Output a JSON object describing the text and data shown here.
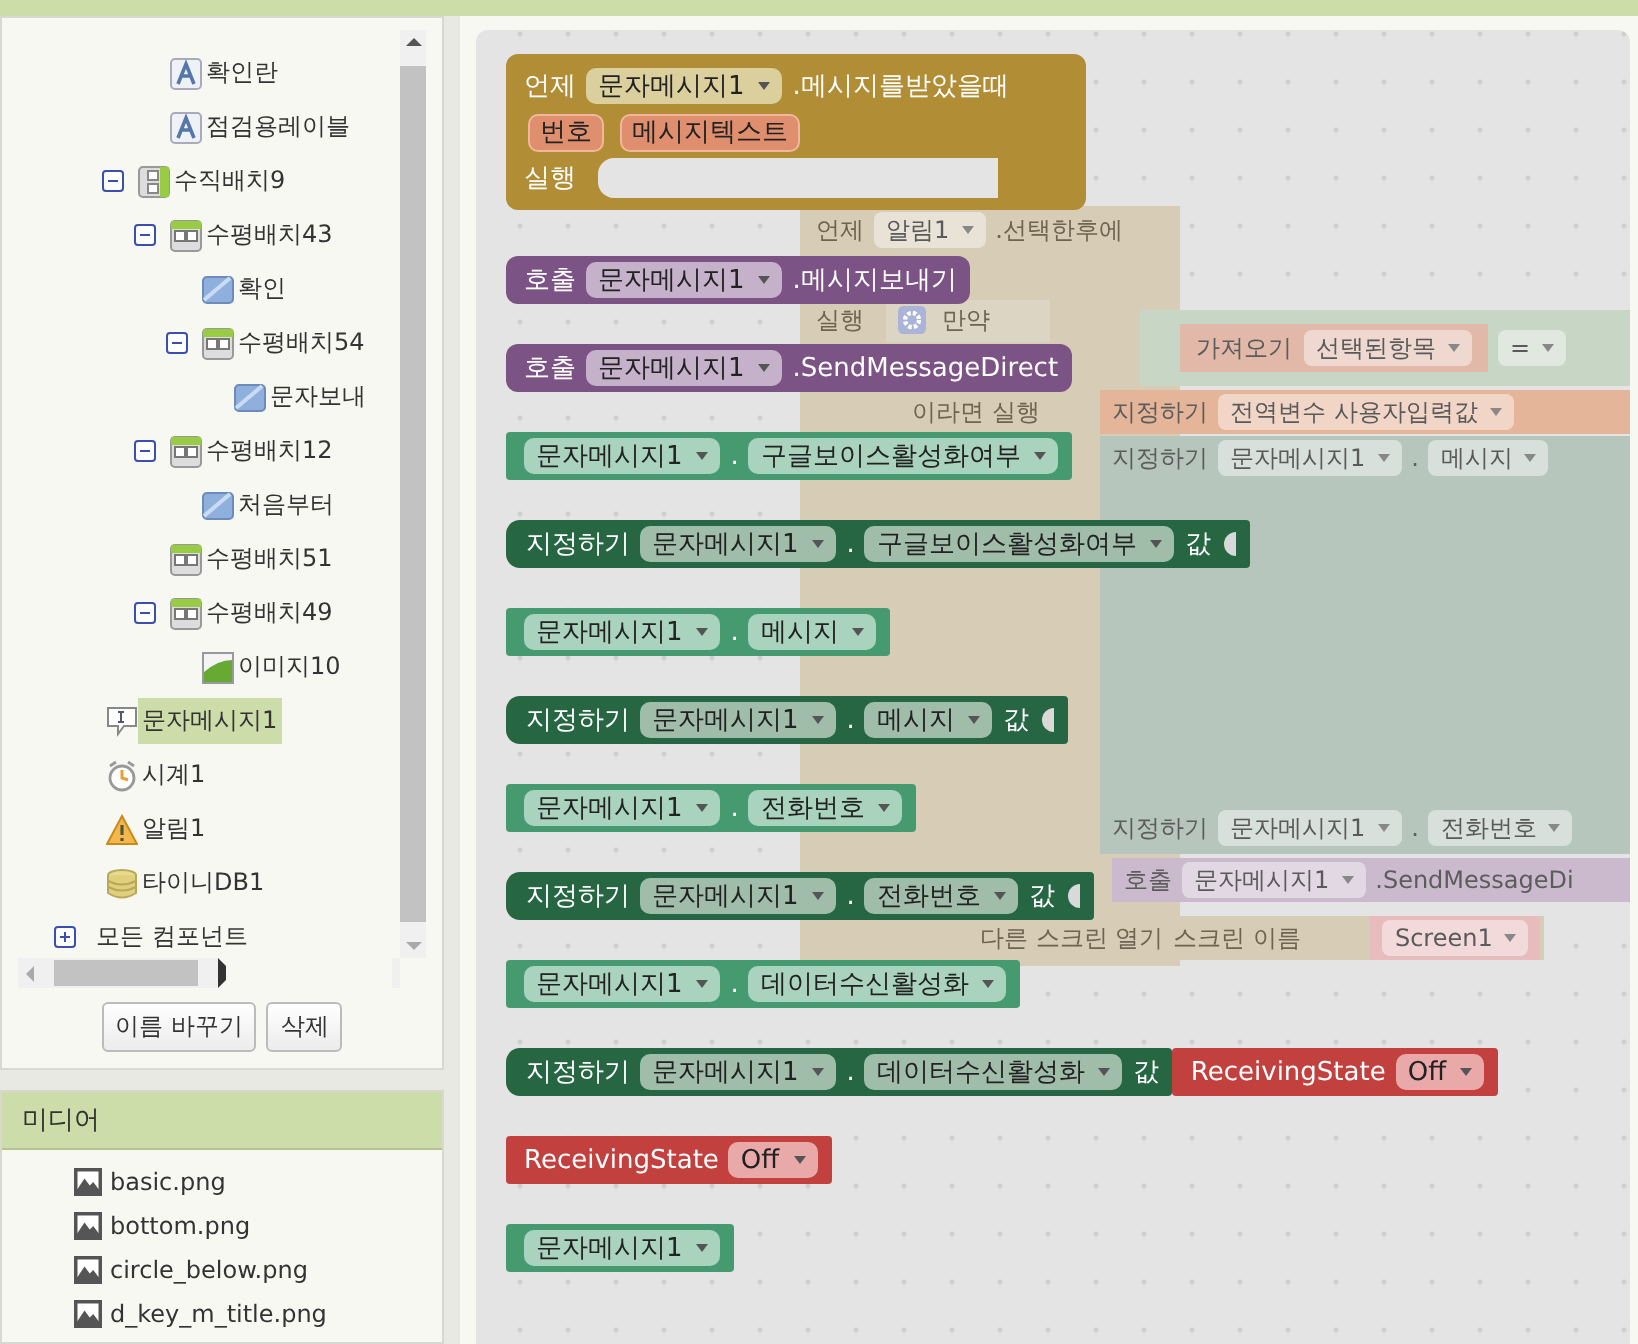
{
  "tree": {
    "nodes": [
      {
        "children": [
          {
            "children": [
              {
                "label": "확인란",
                "kind": "label",
                "selected": false
              },
              {
                "label": "점검용레이블",
                "kind": "label",
                "selected": false
              }
            ]
          },
          {
            "label": "수직배치9",
            "kind": "vertical",
            "selected": false,
            "expanded": true,
            "children": [
              {
                "label": "수평배치43",
                "kind": "horizontal",
                "selected": false,
                "expanded": true,
                "children": [
                  {
                    "label": "확인",
                    "kind": "button",
                    "selected": false
                  },
                  {
                    "label": "수평배치54",
                    "kind": "horizontal",
                    "selected": false,
                    "expanded": true,
                    "children": [
                      {
                        "label": "문자보내",
                        "kind": "button",
                        "selected": false
                      }
                    ]
                  }
                ]
              },
              {
                "label": "수평배치12",
                "kind": "horizontal",
                "selected": false,
                "expanded": true,
                "children": [
                  {
                    "label": "처음부터",
                    "kind": "button",
                    "selected": false
                  }
                ]
              },
              {
                "label": "수평배치51",
                "kind": "horizontal",
                "selected": false
              },
              {
                "label": "수평배치49",
                "kind": "horizontal",
                "selected": false,
                "expanded": true,
                "children": [
                  {
                    "label": "이미지10",
                    "kind": "image",
                    "selected": false
                  }
                ]
              }
            ]
          }
        ]
      },
      {
        "label": "문자메시지1",
        "kind": "texting",
        "selected": true
      },
      {
        "label": "시계1",
        "kind": "clock",
        "selected": false
      },
      {
        "label": "알림1",
        "kind": "notifier",
        "selected": false
      },
      {
        "label": "타이니DB1",
        "kind": "tinydb",
        "selected": false
      }
    ],
    "all_components": {
      "label": "모든 컴포넌트",
      "expanded": false
    }
  },
  "tree_buttons": [
    "이름 바꾸기",
    "삭제"
  ],
  "media": {
    "title": "미디어",
    "files": [
      "basic.png",
      "bottom.png",
      "circle_below.png",
      "d_key_m_title.png"
    ]
  },
  "workspace_blocks": [
    {
      "kind": "event",
      "keyword": "언제",
      "component": "알림1",
      "event": ".선택한후에",
      "do_label": "실행",
      "if_label": "만약",
      "then_label": "이라면 실행"
    },
    {
      "kind": "compare",
      "keyword": "가져오기",
      "variable": "선택된항목",
      "operator": "="
    },
    {
      "kind": "global_setter",
      "keyword": "지정하기",
      "variable": "전역변수 사용자입력값"
    },
    {
      "kind": "setter",
      "keyword": "지정하기",
      "component": "문자메시지1",
      "dot": ".",
      "property": "메시지"
    },
    {
      "kind": "setter",
      "keyword": "지정하기",
      "component": "문자메시지1",
      "dot": ".",
      "property": "전화번호"
    },
    {
      "kind": "call",
      "keyword": "호출",
      "component": "문자메시지1",
      "method": ".SendMessageDi"
    },
    {
      "kind": "open_screen",
      "keyword": "다른 스크린 열기",
      "arg_label": "스크린 이름",
      "value": "Screen1"
    }
  ],
  "flyout_blocks": [
    {
      "kind": "event",
      "keyword": "언제",
      "component": "문자메시지1",
      "event": ".메시지를받았을때",
      "params": [
        "번호",
        "메시지텍스트"
      ],
      "do_label": "실행"
    },
    {
      "kind": "call",
      "keyword": "호출",
      "component": "문자메시지1",
      "method": ".메시지보내기"
    },
    {
      "kind": "call",
      "keyword": "호출",
      "component": "문자메시지1",
      "method": ".SendMessageDirect"
    },
    {
      "kind": "getter",
      "component": "문자메시지1",
      "dot": ".",
      "property": "구글보이스활성화여부"
    },
    {
      "kind": "setter",
      "keyword": "지정하기",
      "component": "문자메시지1",
      "dot": ".",
      "property": "구글보이스활성화여부",
      "to": "값"
    },
    {
      "kind": "getter",
      "component": "문자메시지1",
      "dot": ".",
      "property": "메시지"
    },
    {
      "kind": "setter",
      "keyword": "지정하기",
      "component": "문자메시지1",
      "dot": ".",
      "property": "메시지",
      "to": "값"
    },
    {
      "kind": "getter",
      "component": "문자메시지1",
      "dot": ".",
      "property": "전화번호"
    },
    {
      "kind": "setter",
      "keyword": "지정하기",
      "component": "문자메시지1",
      "dot": ".",
      "property": "전화번호",
      "to": "값"
    },
    {
      "kind": "getter",
      "component": "문자메시지1",
      "dot": ".",
      "property": "데이터수신활성화"
    },
    {
      "kind": "setter",
      "keyword": "지정하기",
      "component": "문자메시지1",
      "dot": ".",
      "property": "데이터수신활성화",
      "to": "값",
      "value": {
        "name": "ReceivingState",
        "option": "Off"
      }
    },
    {
      "kind": "enum",
      "name": "ReceivingState",
      "option": "Off"
    },
    {
      "kind": "component",
      "component": "문자메시지1"
    }
  ]
}
